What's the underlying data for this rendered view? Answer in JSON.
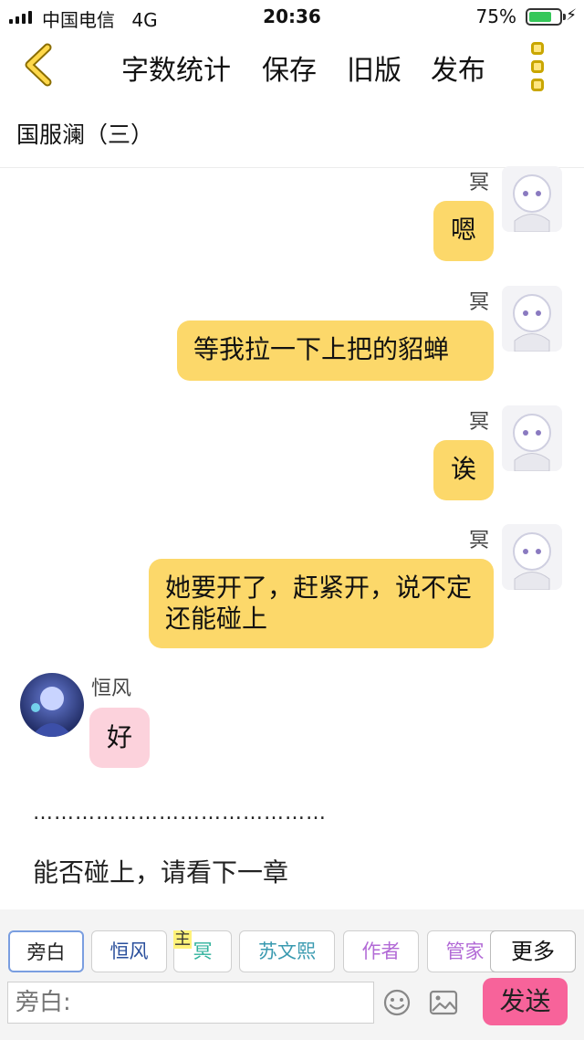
{
  "status_bar": {
    "carrier": "中国电信",
    "network": "4G",
    "time": "20:36",
    "battery_percent": "75%",
    "battery_level": 0.75,
    "battery_color": "#35c759"
  },
  "nav": {
    "back_icon": "chevron-left-icon",
    "word_count": "字数统计",
    "save": "保存",
    "old_version": "旧版",
    "publish": "发布",
    "more_icon": "vertical-dots-menu-icon"
  },
  "chapter_title": "国服澜（三）",
  "messages": [
    {
      "sender": "冥",
      "text": "嗯",
      "side": "right"
    },
    {
      "sender": "冥",
      "text": "等我拉一下上把的貂蝉",
      "side": "right"
    },
    {
      "sender": "冥",
      "text": "诶",
      "side": "right"
    },
    {
      "sender": "冥",
      "text": "她要开了，赶紧开，说不定还能碰上",
      "side": "right"
    },
    {
      "sender": "恒风",
      "text": "好",
      "side": "left"
    }
  ],
  "separator": "……………………………………",
  "narration": "能否碰上，请看下一章",
  "characters": [
    {
      "label": "旁白",
      "color": "#333333",
      "active": true
    },
    {
      "label": "恒风",
      "color": "#2a4f9c",
      "active": false
    },
    {
      "label": "冥",
      "color": "#2fb29c",
      "active": false,
      "tag": "主"
    },
    {
      "label": "苏文熙",
      "color": "#3a9ab0",
      "active": false
    },
    {
      "label": "作者",
      "color": "#b26ad6",
      "active": false
    },
    {
      "label": "管家",
      "color": "#b26ad6",
      "active": false
    }
  ],
  "more_label": "更多",
  "input": {
    "placeholder": "旁白:"
  },
  "send_label": "发送",
  "colors": {
    "right_bubble": "#fcd86a",
    "left_bubble": "#fcd2dc",
    "send_button": "#f7639a"
  }
}
